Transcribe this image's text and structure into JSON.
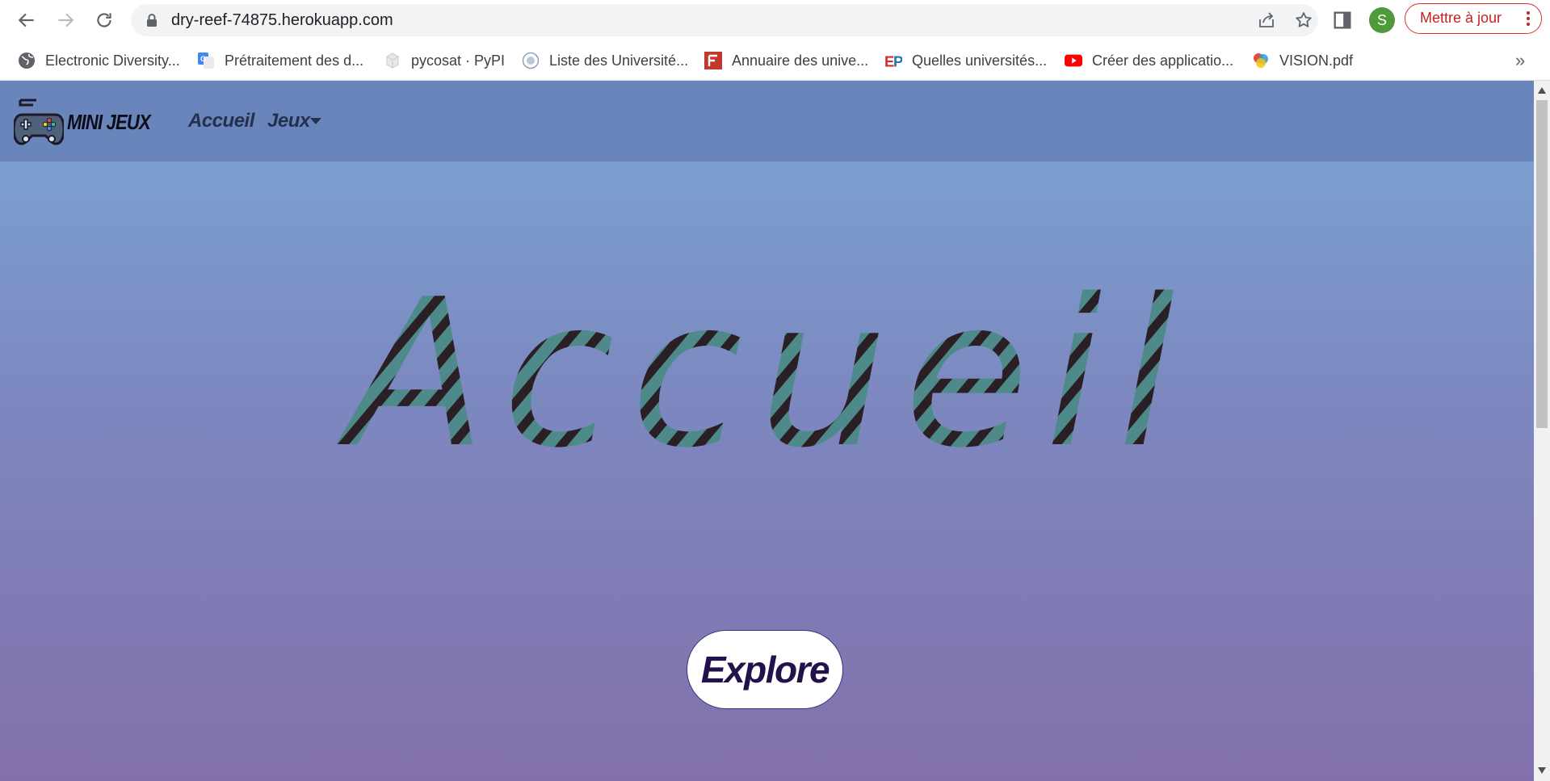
{
  "browser": {
    "url": "dry-reef-74875.herokuapp.com",
    "profile_initial": "S",
    "update_label": "Mettre à jour",
    "bookmarks": [
      {
        "label": "Electronic Diversity...",
        "icon": "globe-icon"
      },
      {
        "label": "Prétraitement des d...",
        "icon": "google-translate-icon"
      },
      {
        "label": "pycosat · PyPI",
        "icon": "pypi-icon"
      },
      {
        "label": "Liste des Université...",
        "icon": "university-seal-icon"
      },
      {
        "label": "Annuaire des unive...",
        "icon": "annuaire-icon"
      },
      {
        "label": "Quelles universités...",
        "icon": "ep-logo-icon"
      },
      {
        "label": "Créer des applicatio...",
        "icon": "youtube-icon"
      },
      {
        "label": "VISION.pdf",
        "icon": "pdf-icon"
      }
    ],
    "more_bookmarks": "»"
  },
  "navbar": {
    "brand": "MINI JEUX",
    "links": [
      {
        "label": "Accueil"
      },
      {
        "label": "Jeux"
      }
    ]
  },
  "hero": {
    "title": "Accueil",
    "button_label": "Explore"
  },
  "colors": {
    "navbar_bg": "#6a84bc",
    "hero_top": "#7b9fcf",
    "hero_bottom": "#8370ab",
    "title_stripe_a": "#4d8a89",
    "title_stripe_b": "#2a1f24",
    "update_accent": "#d93025"
  }
}
